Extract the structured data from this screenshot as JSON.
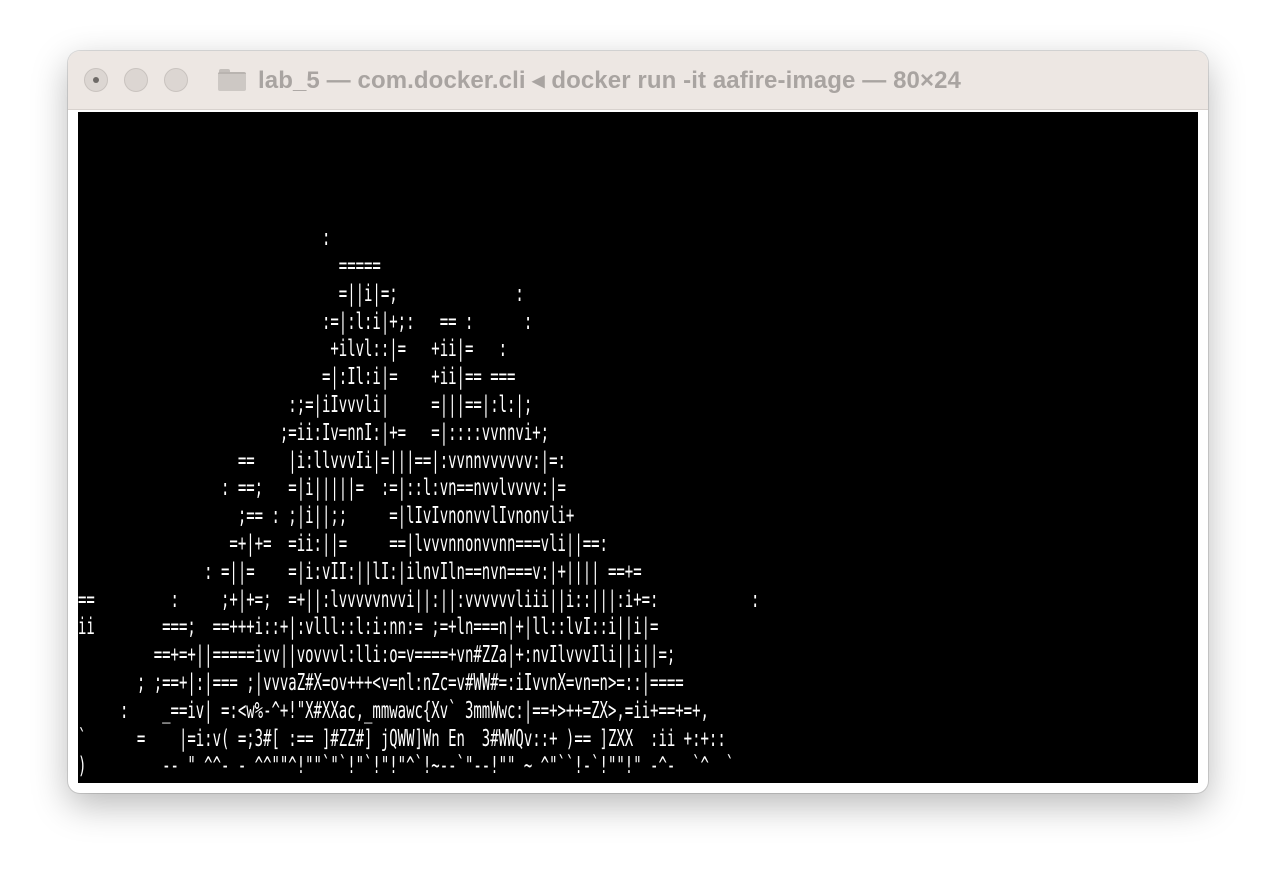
{
  "window": {
    "title": "lab_5 — com.docker.cli ◂ docker run -it aafire-image — 80×24",
    "folder_icon": "folder-icon",
    "traffic_lights": [
      "close-button",
      "minimize-button",
      "zoom-button"
    ]
  },
  "terminal": {
    "background": "#000000",
    "foreground": "#ffffff",
    "columns": 80,
    "rows": 24,
    "lines": [
      "",
      "",
      "",
      "",
      "                             :",
      "                               =====",
      "                               =||i|=;              :",
      "                             :=|:l:i|+;:   == :      :",
      "                              +ilvl::|=   +ii|=   :",
      "                             =|:Il:i|=    +ii|== ===",
      "                         :;=|iIvvvli|     =|||==|:l:|;",
      "                        ;=ii:Iv=nnI:|+=   =|::::vvnnvi+;",
      "                   ==    |i:llvvvIi|=|||==|:vvnnvvvvvv:|=:",
      "                 : ==;   =|i|||||=  :=|::l:vn==nvvlvvvv:|=",
      "                   ;== : ;|i||;;     =|lIvIvnonvvlIvnonvli+",
      "                  =+|+=  =ii:||=     ==|lvvvnnonvvnn===vli||==:",
      "               : =||=    =|i:vII:||lI:|ilnvIln==nvn===v:|+|||| ==+=",
      "==         :     ;+|+=;  =+||:lvvvvvnvvi||:||:vvvvvvliii||i::|||:i+=:           :",
      "ii        ===;  ==+++i::+|:vlll::l:i:nn:= ;=+ln===n|+|ll::lvI::i||i|=",
      "         ==+=+||=====ivv||vovvvl:lli:o=v====+vn#ZZa|+:nvIlvvvIli||i||=;",
      "       ; ;==+|:|=== ;|vvvaZ#X=ov+++<v=nl:nZc=v#WW#=:iIvvnX=vn=n>=::|====",
      "     :    _==iv| =:<w%-^+!\"X#XXac,_mmwawc{Xv` 3mmWwc:|==+>++=ZX>,=ii+==+=+,",
      "`      =    |=i:v( =;3#[ :== ]#ZZ#] jQWW]Wn En  3#WWQv::+ )== ]ZXX  :ii +:+::",
      ")         -- \" ^^- - ^^\"\"^!\"\"`\"`!\"`!\"!\"^`!~--`\"--!\"\" ~ ^\"``!-`!\"\"!\" -^-  `^  `"
    ]
  }
}
